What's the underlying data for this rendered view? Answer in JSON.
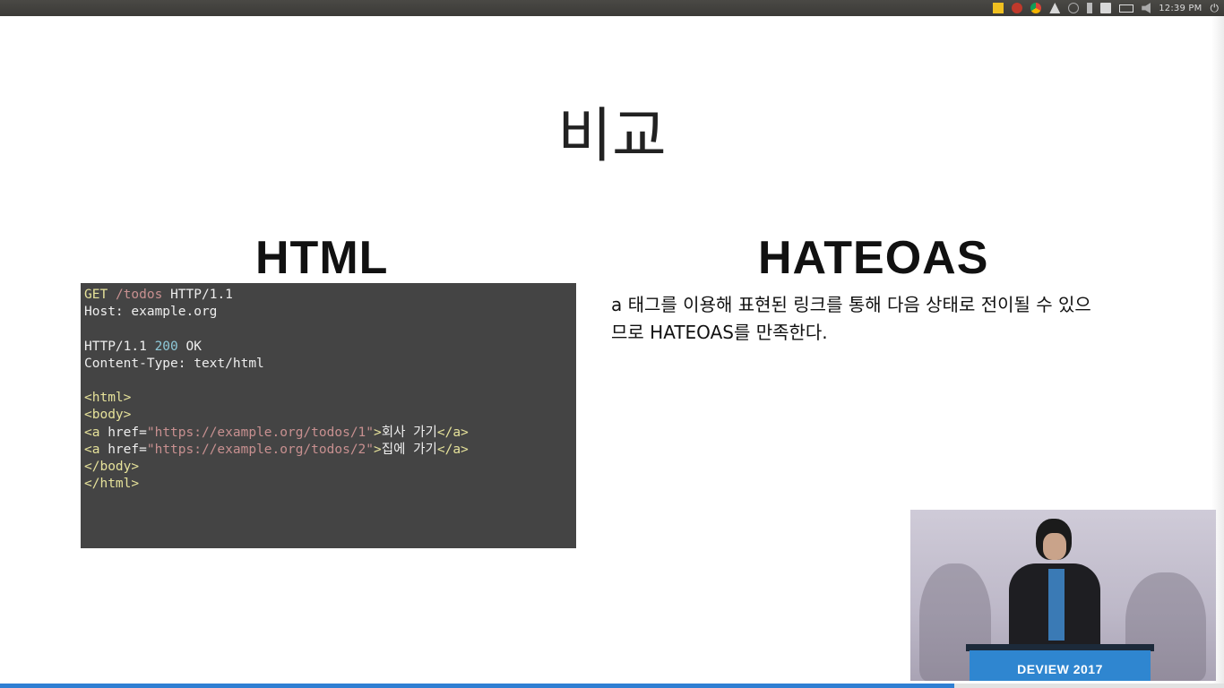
{
  "system_panel": {
    "clock": "12:39 PM",
    "tray_icons": [
      "notes-icon",
      "alert-icon",
      "chrome-icon",
      "acrobat-icon",
      "wifi-icon",
      "bluetooth-icon",
      "mail-icon",
      "battery-icon",
      "volume-icon"
    ],
    "power_icon": "power-icon"
  },
  "slide": {
    "title": "비교",
    "html_heading": "HTML",
    "hateoas_heading": "HATEOAS",
    "hateoas_description_line1": "a 태그를 이용해 표현된 링크를 통해 다음 상태로 전이될 수 있으",
    "hateoas_description_line2": "므로 HATEOAS를 만족한다.",
    "code": {
      "l1_method": "GET",
      "l1_path": "/todos",
      "l1_proto": "HTTP/1.1",
      "l2": "Host: example.org",
      "l4_proto": "HTTP/1.1",
      "l4_status": "200",
      "l4_reason": "OK",
      "l5": "Content-Type: text/html",
      "l7": "<html>",
      "l8": "<body>",
      "l9_open": "<a",
      "l9_attr": "href=",
      "l9_url": "\"https://example.org/todos/1\"",
      "l9_close": ">",
      "l9_text": "회사 가기",
      "l9_end": "</a>",
      "l10_open": "<a",
      "l10_attr": "href=",
      "l10_url": "\"https://example.org/todos/2\"",
      "l10_close": ">",
      "l10_text": "집에 가기",
      "l10_end": "</a>",
      "l11": "</body>",
      "l12": "</html>"
    }
  },
  "video": {
    "podium_label": "DEVIEW 2017"
  },
  "progress": {
    "fraction": 0.78,
    "color": "#2f7fd3"
  }
}
